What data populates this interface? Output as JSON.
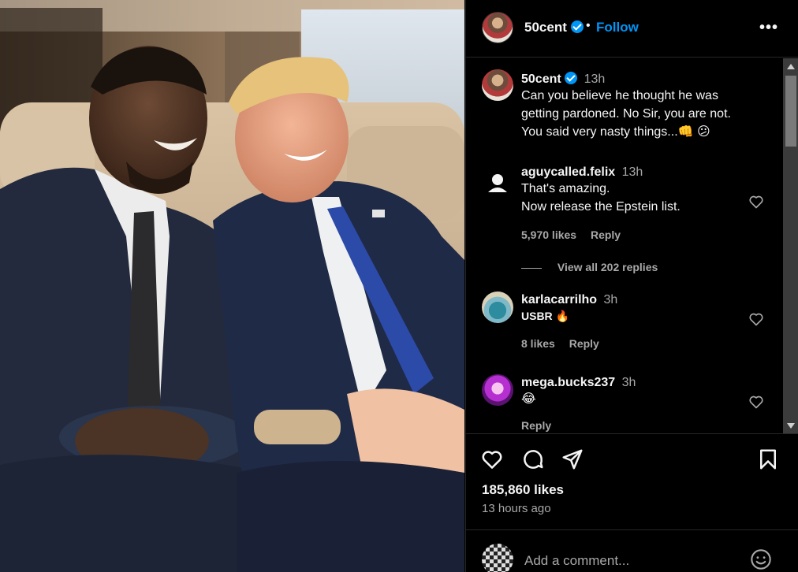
{
  "post": {
    "username": "50cent",
    "separator": "•",
    "follow_label": "Follow",
    "more_label": "•••"
  },
  "caption": {
    "username": "50cent",
    "time": "13h",
    "text_lines": [
      "Can you believe he thought he was",
      "getting pardoned. No Sir, you are not.",
      "You said very nasty things...👊 😕"
    ]
  },
  "comments": [
    {
      "username": "aguycalled.felix",
      "time": "13h",
      "text_lines": [
        "That's amazing.",
        "Now release the Epstein list."
      ],
      "likes": "5,970 likes",
      "reply_label": "Reply",
      "view_replies": "View all 202 replies"
    },
    {
      "username": "karlacarrilho",
      "time": "3h",
      "text": "USBR 🔥",
      "likes": "8 likes",
      "reply_label": "Reply"
    },
    {
      "username": "mega.bucks237",
      "time": "3h",
      "text": "😂",
      "reply_label": "Reply"
    }
  ],
  "actions": {
    "likes": "185,860 likes",
    "time_ago": "13 hours ago"
  },
  "add_comment": {
    "placeholder": "Add a comment..."
  },
  "icons": [
    "verified-badge-icon",
    "more-options-icon",
    "heart-icon",
    "comment-icon",
    "share-icon",
    "bookmark-icon",
    "emoji-icon",
    "default-avatar-icon"
  ],
  "colors": {
    "background": "#000000",
    "link_blue": "#0095f6",
    "text_primary": "#f5f5f5",
    "text_secondary": "#a8a8a8",
    "divider": "#262626"
  }
}
